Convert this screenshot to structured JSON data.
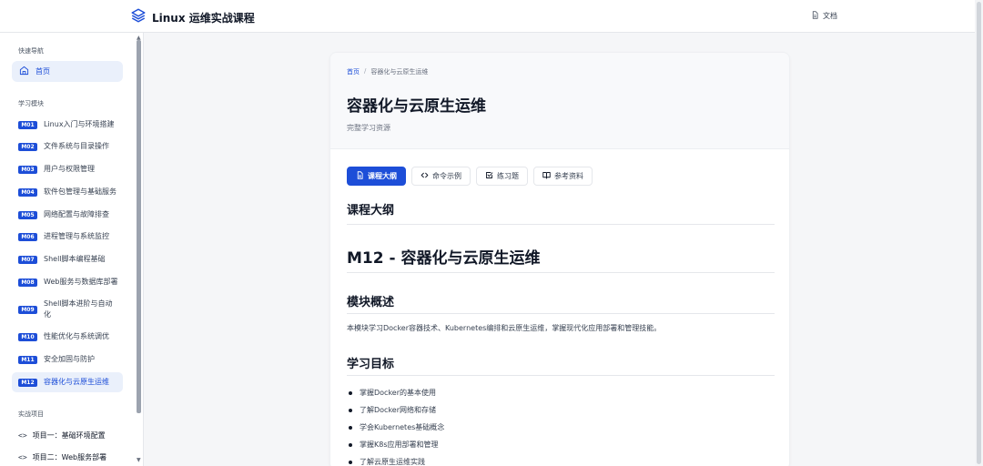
{
  "header": {
    "title": "Linux 运维实战课程",
    "docs_label": "文档"
  },
  "sidebar": {
    "quick_nav_title": "快速导航",
    "home_label": "首页",
    "modules_title": "学习模块",
    "modules": [
      {
        "code": "M01",
        "label": "Linux入门与环境搭建"
      },
      {
        "code": "M02",
        "label": "文件系统与目录操作"
      },
      {
        "code": "M03",
        "label": "用户与权限管理"
      },
      {
        "code": "M04",
        "label": "软件包管理与基础服务"
      },
      {
        "code": "M05",
        "label": "网络配置与故障排查"
      },
      {
        "code": "M06",
        "label": "进程管理与系统监控"
      },
      {
        "code": "M07",
        "label": "Shell脚本编程基础"
      },
      {
        "code": "M08",
        "label": "Web服务与数据库部署"
      },
      {
        "code": "M09",
        "label": "Shell脚本进阶与自动化"
      },
      {
        "code": "M10",
        "label": "性能优化与系统调优"
      },
      {
        "code": "M11",
        "label": "安全加固与防护"
      },
      {
        "code": "M12",
        "label": "容器化与云原生运维"
      }
    ],
    "projects_title": "实战项目",
    "projects": [
      {
        "label": "项目一：基础环境配置"
      },
      {
        "label": "项目二：Web服务部署"
      }
    ]
  },
  "main": {
    "breadcrumb": {
      "home": "首页",
      "separator": "/",
      "current": "容器化与云原生运维"
    },
    "title": "容器化与云原生运维",
    "subtitle": "完整学习资源",
    "tabs": [
      {
        "label": "课程大纲",
        "icon": "file-icon",
        "active": true
      },
      {
        "label": "命令示例",
        "icon": "code-icon",
        "active": false
      },
      {
        "label": "练习题",
        "icon": "checkbox-icon",
        "active": false
      },
      {
        "label": "参考资料",
        "icon": "book-icon",
        "active": false
      }
    ],
    "content": {
      "section_title": "课程大纲",
      "module_heading": "M12 - 容器化与云原生运维",
      "overview_title": "模块概述",
      "overview_text": "本模块学习Docker容器技术、Kubernetes编排和云原生运维，掌握现代化应用部署和管理技能。",
      "goals_title": "学习目标",
      "goals": [
        "掌握Docker的基本使用",
        "了解Docker网络和存储",
        "学会Kubernetes基础概念",
        "掌握K8s应用部署和管理",
        "了解云原生运维实践"
      ]
    }
  },
  "colors": {
    "accent": "#1d4ed8",
    "active_bg": "#eaf0fb"
  }
}
